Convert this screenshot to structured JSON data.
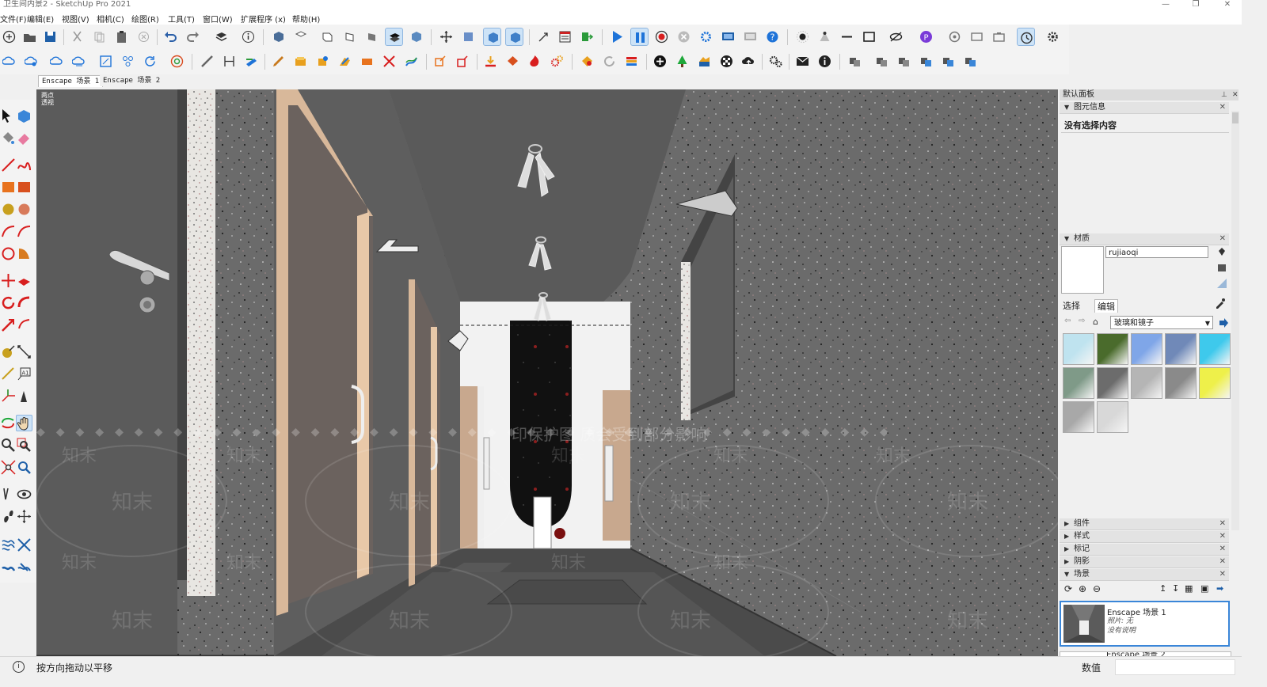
{
  "window": {
    "title": "卫生间内景2 - SketchUp Pro 2021"
  },
  "menu": [
    "文件(F)",
    "编辑(E)",
    "视图(V)",
    "相机(C)",
    "绘图(R)",
    "工具(T)",
    "窗口(W)",
    "扩展程序 (x)",
    "帮助(H)"
  ],
  "scene_tabs": [
    "Enscape 场景 1",
    "Enscape 场景 2"
  ],
  "viewport": {
    "label": "两点透视",
    "watermark": "印保护图 质会受到部分影响",
    "watermark_logo": "知末"
  },
  "tray": {
    "title": "默认面板",
    "entity_info": {
      "label": "图元信息",
      "empty_text": "没有选择内容"
    },
    "materials": {
      "label": "材质",
      "material_name": "rujiaoqi",
      "tab_select": "选择",
      "tab_edit": "编辑",
      "category": "玻璃和镜子",
      "swatches": [
        "#bfe3ef",
        "#4a6b2c",
        "#7fa6e8",
        "#7089b8",
        "#3ec9ec",
        "#7f9a88",
        "#6c6c6c",
        "#b5b5b5",
        "#8a8a8a",
        "#eef04a",
        "#a8a8a8",
        "#d8d8d8"
      ]
    },
    "sections": [
      "组件",
      "样式",
      "标记",
      "阴影",
      "场景"
    ],
    "scene_card": {
      "name": "Enscape 场景 1",
      "photo": "照片: 无",
      "desc": "没有说明"
    },
    "second_scene_name": "Enscape 场景 2"
  },
  "status": {
    "text": "按方向拖动以平移",
    "measure_label": "数值"
  },
  "colors": {
    "accent": "#3a86d8",
    "active_tool": "#cde3f7"
  }
}
